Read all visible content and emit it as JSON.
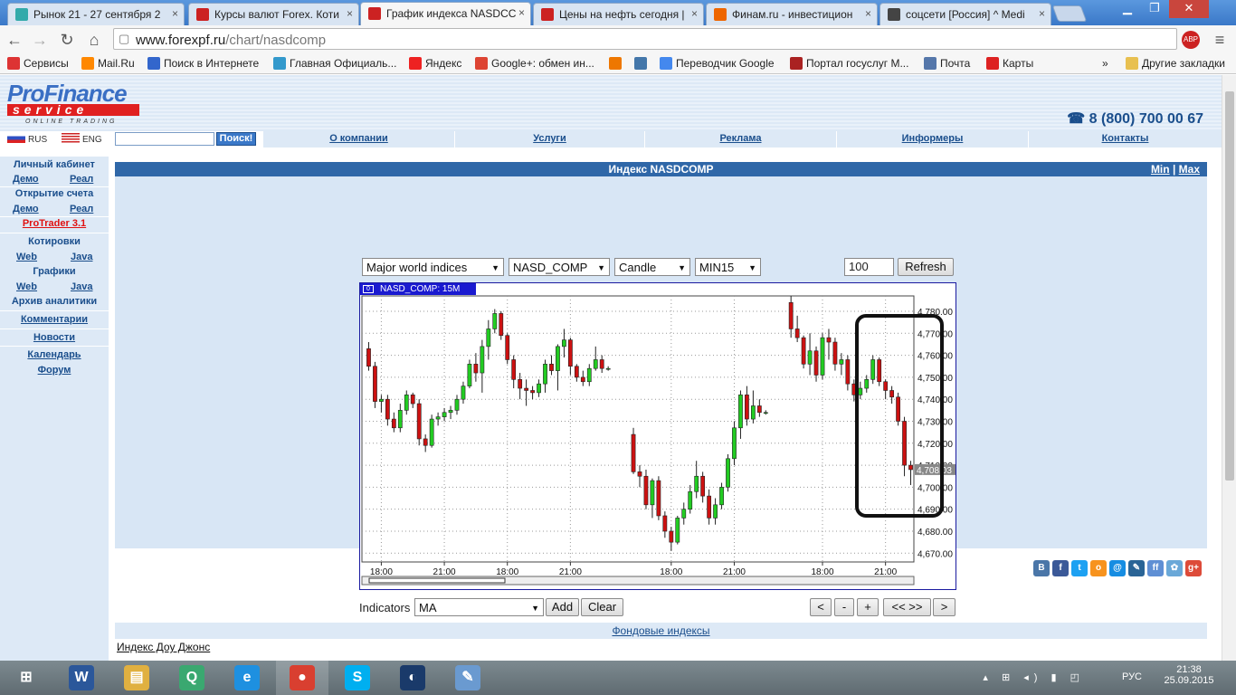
{
  "browser": {
    "tabs": [
      {
        "label": "Рынок 21 - 27 сентября 2",
        "icon": "qf-favicon",
        "color": "#3aa"
      },
      {
        "label": "Курсы валют Forex. Коти",
        "icon": "f-favicon",
        "color": "#c22"
      },
      {
        "label": "График индекса NASDCC",
        "icon": "f-favicon",
        "color": "#c22",
        "active": true
      },
      {
        "label": "Цены на нефть сегодня |",
        "icon": "f-favicon",
        "color": "#c22"
      },
      {
        "label": "Финам.ru - инвестицион",
        "icon": "finam-favicon",
        "color": "#e60"
      },
      {
        "label": "соцсети [Россия] ^ Medi",
        "icon": "m-favicon",
        "color": "#444"
      }
    ],
    "url_domain": "www.forexpf.ru",
    "url_path": "/chart/nasdcomp",
    "bookmarks": [
      {
        "label": "Сервисы",
        "icon": "apps-icon",
        "color": "#d33"
      },
      {
        "label": "Mail.Ru",
        "icon": "mailru-icon",
        "color": "#f80"
      },
      {
        "label": "Поиск в Интернете",
        "icon": "search-icon",
        "color": "#36c"
      },
      {
        "label": "Главная Официаль...",
        "icon": "site-icon",
        "color": "#39c"
      },
      {
        "label": "Яндекс",
        "icon": "yandex-icon",
        "color": "#e22"
      },
      {
        "label": "Google+: обмен ин...",
        "icon": "gplus-icon",
        "color": "#d43"
      },
      {
        "label": "",
        "icon": "shield-icon",
        "color": "#e70"
      },
      {
        "label": "",
        "icon": "vk-icon",
        "color": "#47a"
      },
      {
        "label": "Переводчик Google",
        "icon": "translate-icon",
        "color": "#48e"
      },
      {
        "label": "Портал госуслуг М...",
        "icon": "gov-icon",
        "color": "#a22"
      },
      {
        "label": "Почта",
        "icon": "mail-icon",
        "color": "#57a"
      },
      {
        "label": "Карты",
        "icon": "map-pin-icon",
        "color": "#d22"
      }
    ],
    "bookmarks_more": "»",
    "other_bookmarks": "Другие закладки"
  },
  "site": {
    "logo_main": "ProFinance",
    "logo_service": "service",
    "logo_tagline": "ONLINE TRADING",
    "phone": "☎ 8 (800) 700 00 67",
    "lang_ru": "RUS",
    "lang_en": "ENG",
    "search_button": "Поиск!",
    "menu": [
      "О компании",
      "Услуги",
      "Реклама",
      "Информеры",
      "Контакты"
    ]
  },
  "sidebar": {
    "cabinet": "Личный кабинет",
    "demo1": "Демо",
    "real1": "Реал",
    "open_account": "Открытие счета",
    "demo2": "Демо",
    "real2": "Реал",
    "protrader": "ProTrader 3.1",
    "quotes": "Котировки",
    "web1": "Web",
    "java1": "Java",
    "charts": "Графики",
    "web2": "Web",
    "java2": "Java",
    "analytics": "Архив аналитики",
    "comments": "Комментарии",
    "news": "Новости",
    "calendar": "Календарь",
    "forum": "Форум"
  },
  "panel": {
    "title": "Индекс NASDCOMP",
    "min": "Min",
    "sep": "|",
    "max": "Max",
    "selects": {
      "group": "Major world indices",
      "symbol": "NASD_COMP",
      "type": "Candle",
      "period": "MIN15"
    },
    "count_value": "100",
    "refresh": "Refresh",
    "indicators_label": "Indicators",
    "indicator_value": "MA",
    "add": "Add",
    "clear": "Clear",
    "nav": [
      "<",
      "-",
      "+",
      "<< >>",
      ">"
    ]
  },
  "chart_data": {
    "type": "candlestick",
    "title": "NASD_COMP: 15M",
    "x_ticks": [
      "18:00",
      "21:00",
      "18:00",
      "21:00",
      "18:00",
      "21:00",
      "18:00",
      "21:00"
    ],
    "y_ticks": [
      "4,780.00",
      "4,770.00",
      "4,760.00",
      "4,750.00",
      "4,740.00",
      "4,730.00",
      "4,720.00",
      "4,710.00",
      "4,700.00",
      "4,690.00",
      "4,680.00",
      "4,670.00"
    ],
    "ylim": [
      4666,
      4787
    ],
    "current_price": "4,708.03",
    "up_color": "#22cc22",
    "down_color": "#cc1111",
    "candles": [
      [
        4763,
        4766,
        4753,
        4755
      ],
      [
        4755,
        4757,
        4736,
        4739
      ],
      [
        4739,
        4742,
        4734,
        4740
      ],
      [
        4740,
        4742,
        4728,
        4731
      ],
      [
        4731,
        4734,
        4725,
        4727
      ],
      [
        4727,
        4738,
        4725,
        4735
      ],
      [
        4735,
        4744,
        4733,
        4742
      ],
      [
        4742,
        4743,
        4736,
        4738
      ],
      [
        4738,
        4740,
        4719,
        4722
      ],
      [
        4722,
        4724,
        4716,
        4719
      ],
      [
        4719,
        4733,
        4718,
        4731
      ],
      [
        4731,
        4734,
        4728,
        4732
      ],
      [
        4732,
        4736,
        4730,
        4734
      ],
      [
        4734,
        4737,
        4731,
        4735
      ],
      [
        4735,
        4742,
        4733,
        4740
      ],
      [
        4740,
        4748,
        4738,
        4746
      ],
      [
        4746,
        4758,
        4745,
        4756
      ],
      [
        4756,
        4761,
        4748,
        4752
      ],
      [
        4752,
        4767,
        4743,
        4764
      ],
      [
        4764,
        4776,
        4758,
        4772
      ],
      [
        4772,
        4781,
        4770,
        4779
      ],
      [
        4779,
        4780,
        4767,
        4769
      ],
      [
        4769,
        4770,
        4756,
        4758
      ],
      [
        4758,
        4760,
        4745,
        4749
      ],
      [
        4749,
        4752,
        4740,
        4745
      ],
      [
        4745,
        4749,
        4737,
        4744
      ],
      [
        4744,
        4746,
        4740,
        4743
      ],
      [
        4743,
        4749,
        4741,
        4747
      ],
      [
        4747,
        4758,
        4743,
        4756
      ],
      [
        4756,
        4760,
        4751,
        4753
      ],
      [
        4753,
        4765,
        4744,
        4764
      ],
      [
        4764,
        4772,
        4759,
        4767
      ],
      [
        4767,
        4768,
        4751,
        4755
      ],
      [
        4755,
        4756,
        4748,
        4750
      ],
      [
        4750,
        4753,
        4746,
        4748
      ],
      [
        4748,
        4756,
        4746,
        4754
      ],
      [
        4754,
        4764,
        4753,
        4758
      ],
      [
        4758,
        4760,
        4752,
        4754
      ],
      [
        4754,
        4755,
        4753,
        4754
      ],
      [
        4724,
        4727,
        4706,
        4707
      ],
      [
        4707,
        4710,
        4700,
        4705
      ],
      [
        4705,
        4708,
        4690,
        4692
      ],
      [
        4692,
        4704,
        4686,
        4703
      ],
      [
        4703,
        4705,
        4685,
        4687
      ],
      [
        4687,
        4689,
        4677,
        4680
      ],
      [
        4680,
        4682,
        4671,
        4675
      ],
      [
        4675,
        4687,
        4674,
        4686
      ],
      [
        4686,
        4693,
        4683,
        4690
      ],
      [
        4690,
        4701,
        4688,
        4698
      ],
      [
        4698,
        4712,
        4695,
        4705
      ],
      [
        4705,
        4707,
        4693,
        4696
      ],
      [
        4696,
        4699,
        4683,
        4686
      ],
      [
        4686,
        4695,
        4683,
        4692
      ],
      [
        4692,
        4702,
        4690,
        4700
      ],
      [
        4700,
        4715,
        4698,
        4713
      ],
      [
        4713,
        4730,
        4710,
        4727
      ],
      [
        4727,
        4744,
        4722,
        4742
      ],
      [
        4742,
        4746,
        4728,
        4731
      ],
      [
        4731,
        4744,
        4729,
        4737
      ],
      [
        4737,
        4740,
        4732,
        4734
      ],
      [
        4734,
        4735,
        4733,
        4734
      ],
      [
        4784,
        4787,
        4768,
        4772
      ],
      [
        4772,
        4778,
        4766,
        4768
      ],
      [
        4768,
        4769,
        4754,
        4756
      ],
      [
        4756,
        4770,
        4751,
        4762
      ],
      [
        4762,
        4764,
        4748,
        4751
      ],
      [
        4751,
        4770,
        4749,
        4768
      ],
      [
        4768,
        4772,
        4758,
        4766
      ],
      [
        4766,
        4768,
        4753,
        4756
      ],
      [
        4756,
        4761,
        4751,
        4758
      ],
      [
        4758,
        4760,
        4744,
        4747
      ],
      [
        4747,
        4749,
        4739,
        4742
      ],
      [
        4742,
        4748,
        4740,
        4745
      ],
      [
        4745,
        4751,
        4743,
        4749
      ],
      [
        4749,
        4760,
        4747,
        4758
      ],
      [
        4758,
        4759,
        4746,
        4748
      ],
      [
        4748,
        4749,
        4740,
        4744
      ],
      [
        4744,
        4746,
        4738,
        4741
      ],
      [
        4741,
        4743,
        4728,
        4730
      ],
      [
        4730,
        4732,
        4705,
        4710
      ],
      [
        4710,
        4712,
        4701,
        4708
      ]
    ]
  },
  "share_icons": [
    {
      "icon": "vk-share-icon",
      "label": "B",
      "color": "#4a76a8"
    },
    {
      "icon": "facebook-share-icon",
      "label": "f",
      "color": "#3b5998"
    },
    {
      "icon": "twitter-share-icon",
      "label": "t",
      "color": "#1da1f2"
    },
    {
      "icon": "odnoklassniki-share-icon",
      "label": "o",
      "color": "#f7931e"
    },
    {
      "icon": "mailru-share-icon",
      "label": "@",
      "color": "#168de2"
    },
    {
      "icon": "livejournal-share-icon",
      "label": "✎",
      "color": "#2a6496"
    },
    {
      "icon": "friendfeed-share-icon",
      "label": "ff",
      "color": "#5f8fd4"
    },
    {
      "icon": "moi-krug-share-icon",
      "label": "✿",
      "color": "#6aa8d8"
    },
    {
      "icon": "gplus-share-icon",
      "label": "g+",
      "color": "#dd4b39"
    }
  ],
  "footer": {
    "section_link": "Фондовые индексы",
    "first_item": "Индекс Доу Джонс"
  },
  "taskbar": {
    "apps": [
      {
        "icon": "start-icon",
        "label": "⊞",
        "color": "transparent"
      },
      {
        "icon": "word-icon",
        "label": "W",
        "color": "#2b579a"
      },
      {
        "icon": "explorer-folder-icon",
        "label": "▤",
        "color": "#e0b040"
      },
      {
        "icon": "quik-icon",
        "label": "Q",
        "color": "#3aa870"
      },
      {
        "icon": "ie-icon",
        "label": "e",
        "color": "#1e90e0"
      },
      {
        "icon": "chrome-icon",
        "label": "●",
        "color": "#d93f30"
      },
      {
        "icon": "skype-icon",
        "label": "S",
        "color": "#00aff0"
      },
      {
        "icon": "terminal-app-icon",
        "label": "◐",
        "color": "#1a3a6a"
      },
      {
        "icon": "paint-icon",
        "label": "✎",
        "color": "#6a9ad0"
      }
    ],
    "lang": "РУС",
    "time": "21:38",
    "date": "25.09.2015"
  }
}
